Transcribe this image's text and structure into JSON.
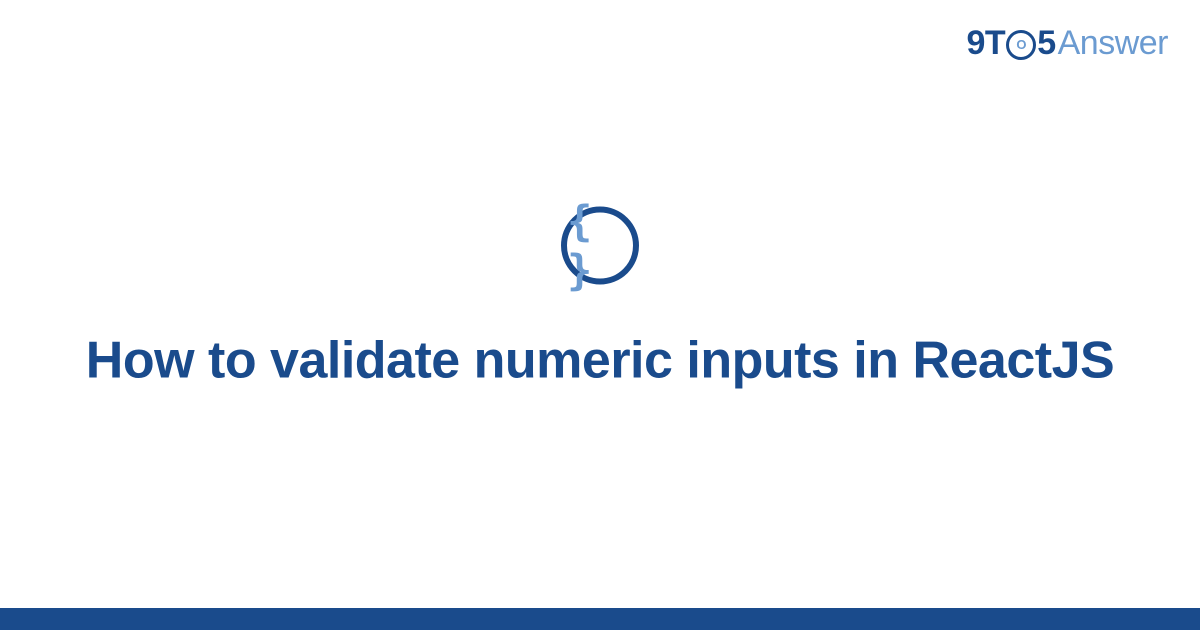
{
  "brand": {
    "nine": "9",
    "t": "T",
    "clock_inner": "O",
    "five": "5",
    "answer": "Answer"
  },
  "icon": {
    "braces": "{ }"
  },
  "title": "How to validate numeric inputs in ReactJS"
}
